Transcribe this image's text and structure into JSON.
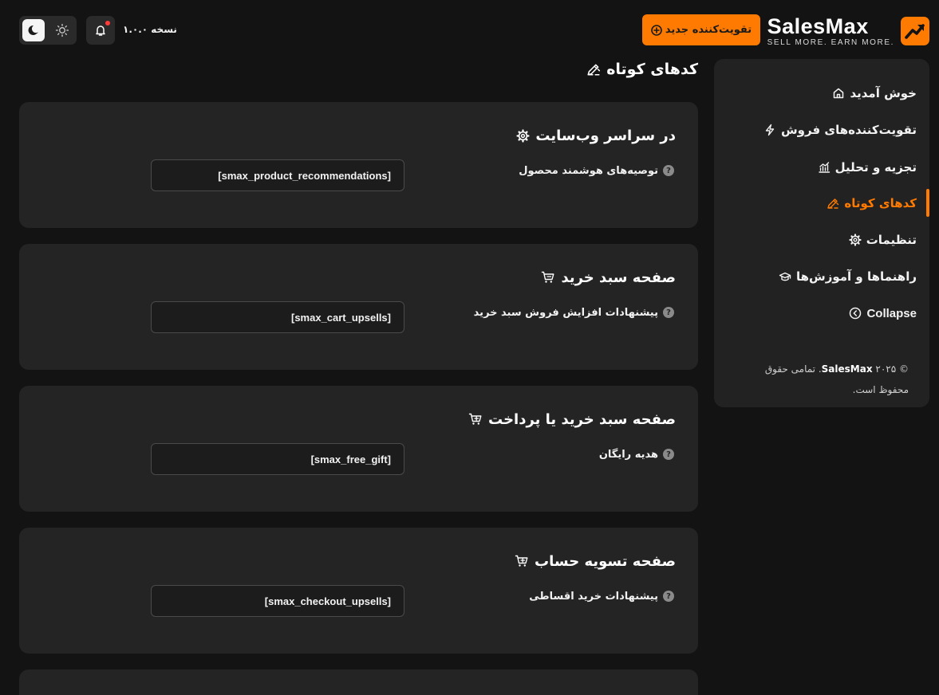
{
  "brand": {
    "name": "SalesMax",
    "tagline": "SELL MORE. EARN MORE.",
    "accent_color": "#ff7a00"
  },
  "header": {
    "new_booster_button": "تقویت‌کننده جدید",
    "new_booster_icon": "plus-circle-icon",
    "version": "نسخه ۱.۰.۰",
    "notification_icon": "bell-icon",
    "theme_icons": [
      "moon-icon",
      "sun-icon"
    ],
    "active_theme": "dark"
  },
  "sidebar": {
    "items": [
      {
        "label": "خوش آمدید",
        "icon": "home-icon",
        "active": false
      },
      {
        "label": "تقویت‌کننده‌های فروش",
        "icon": "bolt-icon",
        "active": false
      },
      {
        "label": "تجزیه و تحلیل",
        "icon": "analytics-icon",
        "active": false
      },
      {
        "label": "کدهای کوتاه",
        "icon": "shortcode-icon",
        "active": true
      },
      {
        "label": "تنظیمات",
        "icon": "gear-icon",
        "active": false
      },
      {
        "label": "راهنماها و آموزش‌ها",
        "icon": "graduation-cap-icon",
        "active": false
      },
      {
        "label": "Collapse",
        "icon": "chevron-left-circle-icon",
        "active": false
      }
    ],
    "copyright_prefix": "© ۲۰۲۵",
    "copyright_brand": "SalesMax",
    "copyright_suffix": ". تمامی حقوق محفوظ است."
  },
  "main": {
    "title": "کدهای کوتاه",
    "sections": [
      {
        "title": "در سراسر وب‌سایت",
        "icon": "gear-icon",
        "label": "توصیه‌های هوشمند محصول",
        "shortcode": "[smax_product_recommendations]"
      },
      {
        "title": "صفحه سبد خرید",
        "icon": "cart-icon",
        "label": "پیشنهادات افزایش فروش سبد خرید",
        "shortcode": "[smax_cart_upsells]"
      },
      {
        "title": "صفحه سبد خرید یا پرداخت",
        "icon": "cart-plus-icon",
        "label": "هدیه رایگان",
        "shortcode": "[smax_free_gift]"
      },
      {
        "title": "صفحه تسویه حساب",
        "icon": "cart-plus-icon",
        "label": "پیشنهادات خرید اقساطی",
        "shortcode": "[smax_checkout_upsells]"
      }
    ],
    "help_glyph": "?"
  }
}
